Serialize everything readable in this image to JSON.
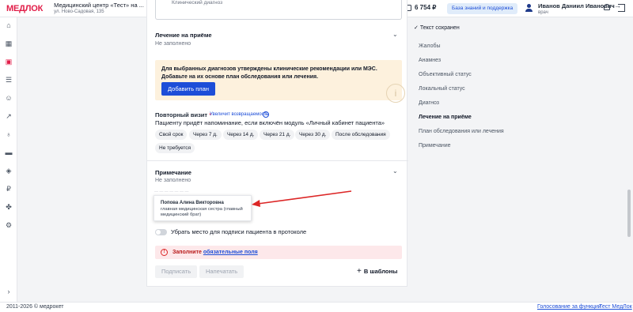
{
  "header": {
    "logo": "МЕДЛОК",
    "clinic_name": "Медицинский центр «Тест» на ...",
    "clinic_address": "ул. Ново-Садовая, 135",
    "balance": "6 754 ₽",
    "kb_button": "База знаний и поддержка",
    "user_name": "Иванов Даниил Иванович",
    "user_role": "врач"
  },
  "form": {
    "prev_field_text": "Клинический диагноз",
    "treatment_title": "Лечение на приёме",
    "treatment_value": "Не заполнено",
    "notice_text": "Для выбранных диагнозов утверждены клинические рекомендации или МЭС. Добавьте на их основе план обследования или лечения.",
    "notice_button": "Добавить план",
    "repeat_title": "Повторный визит",
    "repeat_required": "*",
    "repeat_hint": "Увеличит возвращаемость",
    "repeat_sub": "Пациенту придёт напоминание, если включён модуль «Личный кабинет пациента»",
    "chips": [
      "Свой срок",
      "Через 7 д.",
      "Через 14 д.",
      "Через 21 д.",
      "Через 30 д.",
      "После обследования",
      "Не требуется"
    ],
    "note_title": "Примечание",
    "note_value": "Не заполнено",
    "toggle_label": "Убрать место для подписи пациента в протоколе",
    "error_prefix": "Заполните",
    "error_link": "обязательные поля",
    "btn_sign": "Подписать",
    "btn_print": "Напечатать",
    "btn_templates": "В шаблоны"
  },
  "popup": {
    "name": "Попова Алина Викторовна",
    "role": "главная медицинская сестра (главный медицинский брат)"
  },
  "right_nav": {
    "saved": "Текст сохранен",
    "items": [
      "Жалобы",
      "Анамнез",
      "Объективный статус",
      "Локальный статус",
      "Диагноз",
      "Лечение на приёме",
      "План обследования или лечения",
      "Примечание"
    ],
    "active_index": 5
  },
  "footer": {
    "copyright": "2011-2026 © медрокет",
    "link1": "Голосование за функции",
    "link2": "Тест МедЛок"
  },
  "colors": {
    "brand": "#e11d48",
    "primary": "#1d4ed8",
    "notice_bg": "#fdf1dd",
    "error_bg": "#fde8ea",
    "arrow": "#dc2626"
  }
}
